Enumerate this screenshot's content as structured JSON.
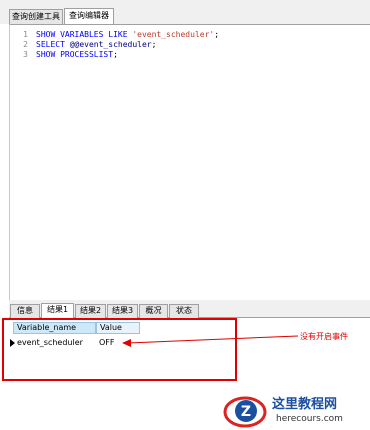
{
  "top_tabs": [
    {
      "label": "查询创建工具",
      "active": false
    },
    {
      "label": "查询编辑器",
      "active": true
    }
  ],
  "editor": {
    "line_numbers": [
      "1",
      "2",
      "3"
    ],
    "lines": [
      {
        "kw": "SHOW VARIABLES LIKE ",
        "str": "'event_scheduler'",
        "end": ";"
      },
      {
        "kw": "SELECT ",
        "plain": "@@event_scheduler",
        "end": ";"
      },
      {
        "kw": "SHOW PROCESSLIST",
        "end": ";"
      }
    ]
  },
  "result_tabs": [
    {
      "label": "信息",
      "active": false
    },
    {
      "label": "结果1",
      "active": true
    },
    {
      "label": "结果2",
      "active": false
    },
    {
      "label": "结果3",
      "active": false
    },
    {
      "label": "概况",
      "active": false
    },
    {
      "label": "状态",
      "active": false
    }
  ],
  "grid": {
    "columns": [
      "Variable_name",
      "Value"
    ],
    "rows": [
      [
        "event_scheduler",
        "OFF"
      ]
    ]
  },
  "annotation": {
    "note": "没有开启事件",
    "color": "#e00000"
  },
  "watermark": {
    "title": "这里教程网",
    "url": "herecours.com"
  },
  "colors": {
    "keyword": "#0000ff",
    "string": "#c0392b",
    "header_bg": "#cde8f8",
    "annotation": "#e00000"
  }
}
